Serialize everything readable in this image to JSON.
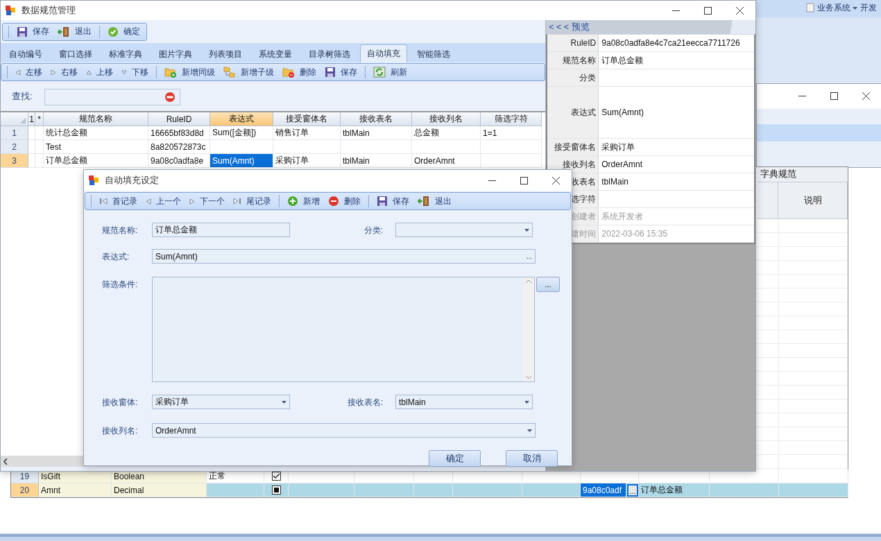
{
  "top_menu": [
    {
      "label": "业务系统",
      "dropdown": true
    },
    {
      "label": "开发",
      "dropdown": false
    }
  ],
  "main_window": {
    "title": "数据规范管理",
    "toolbar": [
      [
        {
          "label": "保存",
          "kind": "save"
        },
        {
          "label": "退出",
          "kind": "exit"
        }
      ],
      [
        {
          "label": "确定",
          "kind": "ok"
        }
      ]
    ],
    "tabs": [
      {
        "label": "自动编号",
        "selected": false
      },
      {
        "label": "窗口选择",
        "selected": false
      },
      {
        "label": "标准字典",
        "selected": false
      },
      {
        "label": "图片字典",
        "selected": false
      },
      {
        "label": "列表项目",
        "selected": false
      },
      {
        "label": "系统变量",
        "selected": false
      },
      {
        "label": "目录树筛选",
        "selected": false
      },
      {
        "label": "自动填充",
        "selected": true
      },
      {
        "label": "智能筛选",
        "selected": false
      }
    ],
    "sub_toolbar": [
      [
        {
          "label": "左移",
          "kind": "left"
        },
        {
          "label": "右移",
          "kind": "right"
        },
        {
          "label": "上移",
          "kind": "up"
        },
        {
          "label": "下移",
          "kind": "down"
        }
      ],
      [
        {
          "label": "新增同级",
          "kind": "add-sibling"
        },
        {
          "label": "新增子级",
          "kind": "add-child"
        },
        {
          "label": "删除",
          "kind": "delete"
        },
        {
          "label": "保存",
          "kind": "save"
        }
      ],
      [
        {
          "label": "刷新",
          "kind": "refresh"
        }
      ]
    ],
    "search": {
      "label": "查找:"
    },
    "grid": {
      "columns": [
        {
          "label": "1",
          "selected": false
        },
        {
          "label": "*",
          "selected": false
        },
        {
          "label": "规范名称",
          "selected": false
        },
        {
          "label": "RuleID",
          "selected": false
        },
        {
          "label": "表达式",
          "selected": true
        },
        {
          "label": "接受窗体名",
          "selected": false
        },
        {
          "label": "接收表名",
          "selected": false
        },
        {
          "label": "接收列名",
          "selected": false
        },
        {
          "label": "筛选字符",
          "selected": false
        }
      ],
      "rows": [
        {
          "number": "1",
          "selected": false,
          "cells": [
            {
              "selected": false
            },
            {
              "selected": false
            },
            {
              "text": "统计总金额",
              "selected": false
            },
            {
              "text": "16665bf83d8d",
              "selected": false
            },
            {
              "text": "Sum([金额])",
              "selected": false
            },
            {
              "text": "销售订单",
              "selected": false
            },
            {
              "text": "tblMain",
              "selected": false
            },
            {
              "text": "总金额",
              "selected": false
            },
            {
              "text": "1=1",
              "selected": false
            }
          ]
        },
        {
          "number": "2",
          "selected": false,
          "cells": [
            {
              "selected": false
            },
            {
              "selected": false
            },
            {
              "text": "Test",
              "selected": false
            },
            {
              "text": "8a820572873c",
              "selected": false
            },
            {
              "selected": false
            },
            {
              "selected": false
            },
            {
              "selected": false
            },
            {
              "selected": false
            },
            {
              "selected": false
            }
          ]
        },
        {
          "number": "3",
          "selected": true,
          "cells": [
            {
              "selected": false
            },
            {
              "selected": false
            },
            {
              "text": "订单总金额",
              "selected": false
            },
            {
              "text": "9a08c0adfa8e",
              "selected": false
            },
            {
              "text": "Sum(Amnt)",
              "selected": true
            },
            {
              "text": "采购订单",
              "selected": false
            },
            {
              "text": "tblMain",
              "selected": false
            },
            {
              "text": "OrderAmnt",
              "selected": false
            },
            {
              "selected": false
            }
          ]
        }
      ]
    },
    "preview": {
      "title": "< < < 预览",
      "properties": [
        {
          "label": "RuleID",
          "value": "9a08c0adfa8e4c7ca21eecca7711726",
          "disabled": false,
          "tall": false
        },
        {
          "label": "规范名称",
          "value": "订单总金额",
          "disabled": false,
          "tall": false
        },
        {
          "label": "分类",
          "disabled": false,
          "tall": false
        },
        {
          "label": "表达式",
          "value": "Sum(Amnt)",
          "disabled": false,
          "tall": true
        },
        {
          "label": "接受窗体名",
          "value": "采购订单",
          "disabled": false,
          "tall": false
        },
        {
          "label": "接收列名",
          "value": "OrderAmnt",
          "disabled": false,
          "tall": false
        },
        {
          "label": "收表名",
          "value": "tblMain",
          "disabled": false,
          "tall": false
        },
        {
          "label": "选字符",
          "disabled": false,
          "tall": false
        },
        {
          "label": "创建者",
          "value": "系统开发者",
          "disabled": true,
          "tall": false
        },
        {
          "label": "建时间",
          "value": "2022-03-06 15:35",
          "disabled": true,
          "tall": false
        }
      ]
    }
  },
  "dictionary_grid": {
    "group_header": "字典规范",
    "column_header": "说明",
    "rows": [
      {
        "number": "19",
        "selected": false,
        "cells": [
          {
            "kind": "text",
            "text": "IsGift",
            "shaded": true,
            "selected": false
          },
          {
            "kind": "text",
            "text": "Boolean",
            "shaded": true,
            "selected": false
          },
          {
            "kind": "text",
            "text": "正常",
            "shaded": false,
            "selected": false
          },
          {
            "kind": "check",
            "checked": true,
            "indeterminate": false
          },
          {
            "kind": "blank"
          },
          {
            "kind": "blank"
          },
          {
            "kind": "blank"
          },
          {
            "kind": "blank"
          },
          {
            "kind": "blank"
          },
          {
            "kind": "blank"
          },
          {
            "kind": "blank"
          },
          {
            "kind": "blank"
          },
          {
            "kind": "blank"
          }
        ]
      },
      {
        "number": "20",
        "selected": true,
        "cells": [
          {
            "kind": "text",
            "text": "Amnt",
            "shaded": true,
            "selected": false
          },
          {
            "kind": "text",
            "text": "Decimal",
            "shaded": true,
            "selected": false
          },
          {
            "kind": "blank"
          },
          {
            "kind": "check",
            "checked": false,
            "indeterminate": true
          },
          {
            "kind": "blank"
          },
          {
            "kind": "blank"
          },
          {
            "kind": "blank"
          },
          {
            "kind": "blank"
          },
          {
            "kind": "blank"
          },
          {
            "kind": "picker",
            "text": "9a08c0adf",
            "button": "...",
            "selected": true
          },
          {
            "kind": "text",
            "text": "订单总金额",
            "shaded": false,
            "selected": false
          },
          {
            "kind": "blank"
          },
          {
            "kind": "blank"
          }
        ]
      }
    ]
  },
  "dialog": {
    "title": "自动填充设定",
    "toolbar": [
      [
        {
          "label": "首记录",
          "kind": "first"
        },
        {
          "label": "上一个",
          "kind": "prev"
        },
        {
          "label": "下一个",
          "kind": "next"
        },
        {
          "label": "尾记录",
          "kind": "last"
        }
      ],
      [
        {
          "label": "新增",
          "kind": "add"
        },
        {
          "label": "删除",
          "kind": "remove"
        }
      ],
      [
        {
          "label": "保存",
          "kind": "save"
        },
        {
          "label": "退出",
          "kind": "exit"
        }
      ]
    ],
    "form_rows": [
      [
        {
          "label": "规范名称:",
          "kind": "text",
          "value": "订单总金额"
        },
        {
          "label": "分类:",
          "kind": "combo"
        }
      ],
      [
        {
          "label": "表达式:",
          "kind": "picker",
          "value": "Sum(Amnt)",
          "button": "..."
        }
      ],
      [
        {
          "label": "筛选条件:",
          "kind": "memo",
          "button": "..."
        }
      ],
      [
        {
          "label": "接收窗体:",
          "kind": "combo",
          "value": "采购订单"
        },
        {
          "label": "接收表名:",
          "kind": "combo",
          "value": "tblMain"
        }
      ],
      [
        {
          "label": "接收列名:",
          "kind": "combo",
          "value": "OrderAmnt"
        }
      ]
    ],
    "buttons": [
      "确定",
      "取消"
    ]
  }
}
